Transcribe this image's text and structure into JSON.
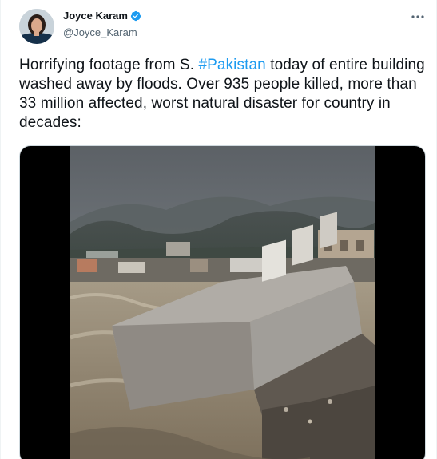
{
  "author": {
    "display_name": "Joyce Karam",
    "handle": "@Joyce_Karam",
    "verified_icon": "verified-badge-icon",
    "verified_color": "#1d9bf0"
  },
  "tweet": {
    "text_before": "Horrifying footage from S. ",
    "hashtag": "#Pakistan",
    "text_after": " today of entire building washed away by floods. Over 935 people killed, more than 33 million affected, worst natural disaster for country in decades:",
    "hashtag_color": "#1d9bf0"
  },
  "media": {
    "type": "video"
  },
  "icons": {
    "more": "more-horizontal-icon",
    "avatar": "avatar"
  }
}
